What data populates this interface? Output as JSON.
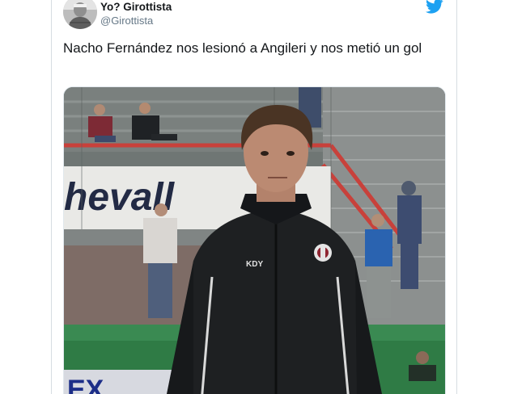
{
  "tweet": {
    "display_name": "Yo? Girottista",
    "handle": "@Girottista",
    "text": "Nacho Fernández nos lesionó a Angileri y nos metió un gol"
  },
  "icons": {
    "brand": "twitter-bird-icon",
    "avatar": "avatar-photo"
  },
  "media": {
    "signage_text": "hevall",
    "bottom_board_text": "EX",
    "jacket_logo_text": "KDY"
  },
  "colors": {
    "twitter_blue": "#1da1f2",
    "text_primary": "#14171a",
    "text_secondary": "#657786",
    "border": "#e1e8ed",
    "pitch_green": "#2f7b45",
    "railing_red": "#c8413b"
  }
}
